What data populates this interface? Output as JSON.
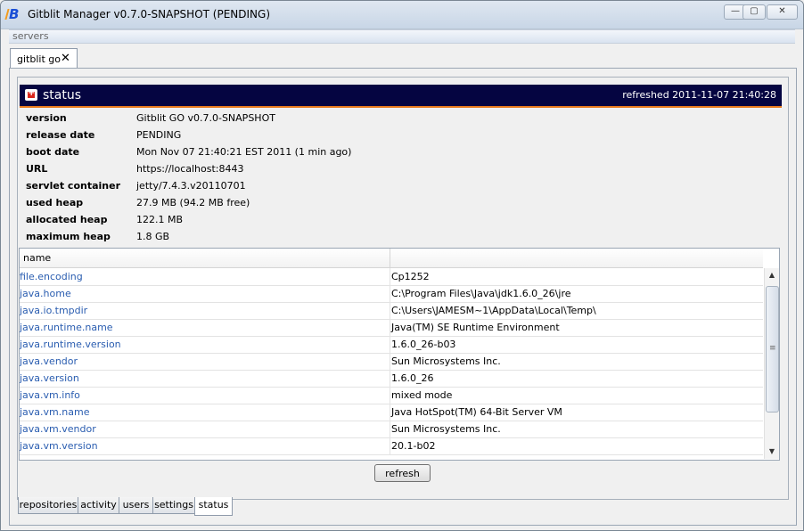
{
  "window": {
    "title": "Gitblit Manager v0.7.0-SNAPSHOT (PENDING)",
    "min_glyph": "—",
    "max_glyph": "▢",
    "close_glyph": "✕",
    "logo_letter": "B"
  },
  "servers_label": "servers",
  "top_tab": {
    "label": "gitblit go",
    "close_glyph": "✕"
  },
  "header": {
    "title": "status",
    "refreshed": "refreshed 2011-11-07 21:40:28"
  },
  "info": [
    {
      "key": "version",
      "value": "Gitblit GO v0.7.0-SNAPSHOT"
    },
    {
      "key": "release date",
      "value": "PENDING"
    },
    {
      "key": "boot date",
      "value": "Mon Nov 07 21:40:21 EST 2011 (1 min ago)"
    },
    {
      "key": "URL",
      "value": "https://localhost:8443"
    },
    {
      "key": "servlet container",
      "value": "jetty/7.4.3.v20110701"
    },
    {
      "key": "used heap",
      "value": "27.9 MB (94.2 MB free)"
    },
    {
      "key": "allocated heap",
      "value": "122.1 MB"
    },
    {
      "key": "maximum heap",
      "value": "1.8 GB"
    }
  ],
  "table": {
    "columns": [
      "name",
      ""
    ],
    "rows": [
      {
        "name": "file.encoding",
        "value": "Cp1252"
      },
      {
        "name": "java.home",
        "value": "C:\\Program Files\\Java\\jdk1.6.0_26\\jre"
      },
      {
        "name": "java.io.tmpdir",
        "value": "C:\\Users\\JAMESM~1\\AppData\\Local\\Temp\\"
      },
      {
        "name": "java.runtime.name",
        "value": "Java(TM) SE Runtime Environment"
      },
      {
        "name": "java.runtime.version",
        "value": "1.6.0_26-b03"
      },
      {
        "name": "java.vendor",
        "value": "Sun Microsystems Inc."
      },
      {
        "name": "java.version",
        "value": "1.6.0_26"
      },
      {
        "name": "java.vm.info",
        "value": "mixed mode"
      },
      {
        "name": "java.vm.name",
        "value": "Java HotSpot(TM) 64-Bit Server VM"
      },
      {
        "name": "java.vm.vendor",
        "value": "Sun Microsystems Inc."
      },
      {
        "name": "java.vm.version",
        "value": "20.1-b02"
      }
    ]
  },
  "scroll": {
    "up": "▲",
    "down": "▼",
    "grip": "≡"
  },
  "refresh_label": "refresh",
  "bottom_tabs": [
    {
      "label": "repositories"
    },
    {
      "label": "activity"
    },
    {
      "label": "users"
    },
    {
      "label": "settings"
    },
    {
      "label": "status"
    }
  ],
  "active_bottom_tab": "status"
}
